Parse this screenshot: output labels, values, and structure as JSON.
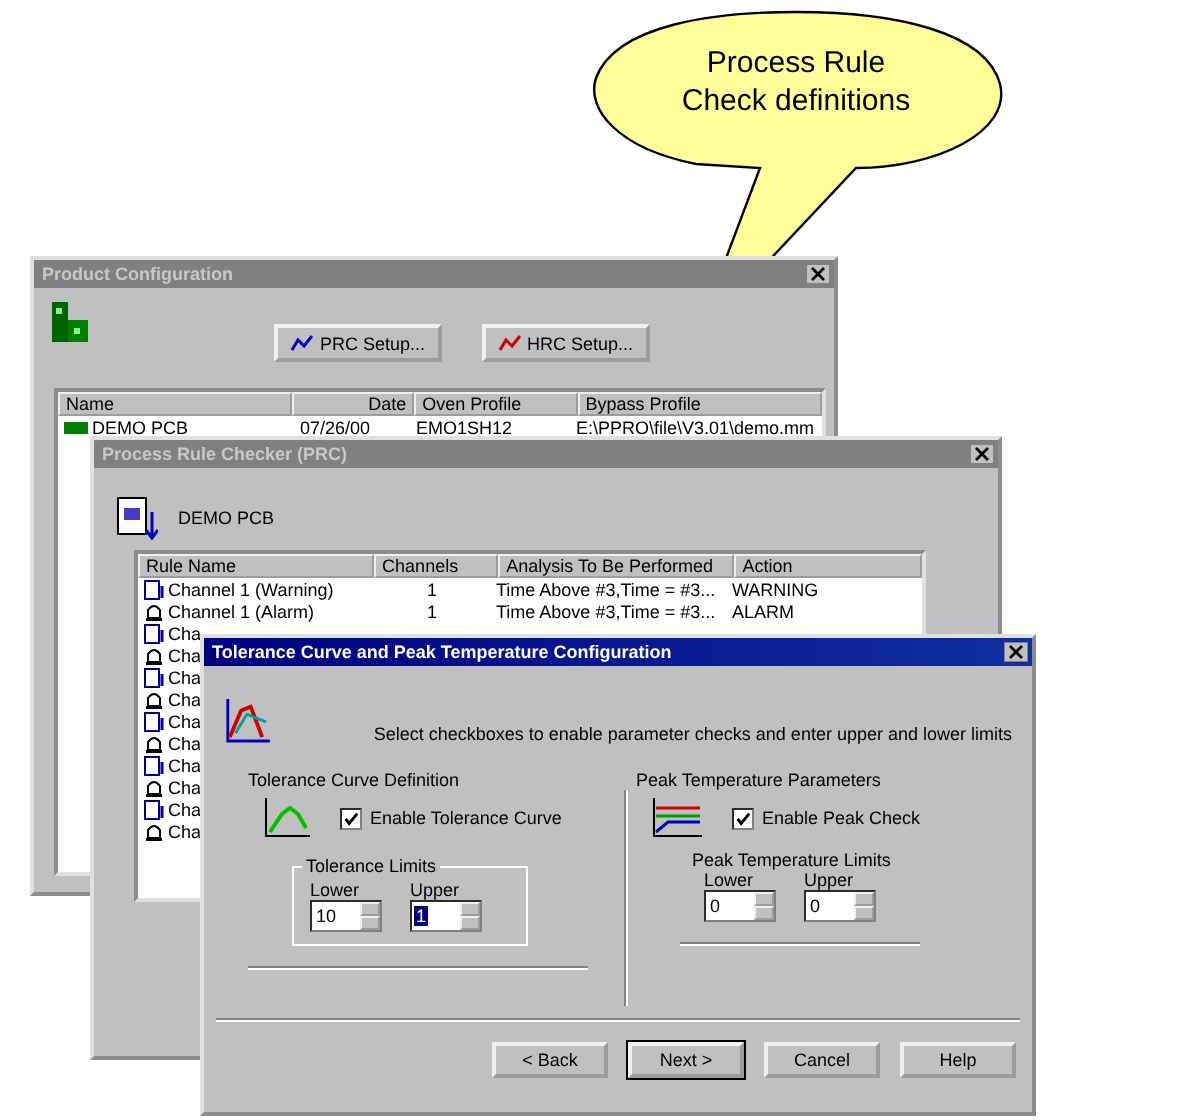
{
  "callout": {
    "lines": [
      "Process Rule",
      "Check definitions"
    ]
  },
  "product_configuration": {
    "title": "Product Configuration",
    "active": false,
    "buttons": [
      "PRC Setup...",
      "HRC Setup..."
    ],
    "columns": [
      "Name",
      "Date",
      "Oven Profile",
      "Bypass Profile"
    ],
    "rows": [
      {
        "cells": [
          "DEMO PCB",
          "07/26/00",
          "EMO1SH12",
          "E:\\PPRO\\file\\V3.01\\demo.mm"
        ]
      }
    ]
  },
  "rule_checker": {
    "title": "Process Rule Checker (PRC)",
    "active": false,
    "product": "DEMO PCB",
    "columns": [
      "Rule Name",
      "Channels",
      "Analysis To Be Performed",
      "Action"
    ],
    "rows": [
      {
        "kind": "warning",
        "name": "Channel 1 (Warning)",
        "channels": "1",
        "analysis": "Time Above #3,Time = #3...",
        "action": "WARNING"
      },
      {
        "kind": "alarm",
        "name": "Channel 1 (Alarm)",
        "channels": "1",
        "analysis": "Time Above #3,Time = #3...",
        "action": "ALARM"
      },
      {
        "kind": "warning",
        "name": "Cha"
      },
      {
        "kind": "alarm",
        "name": "Cha"
      },
      {
        "kind": "warning",
        "name": "Cha"
      },
      {
        "kind": "alarm",
        "name": "Cha"
      },
      {
        "kind": "warning",
        "name": "Cha"
      },
      {
        "kind": "alarm",
        "name": "Cha"
      },
      {
        "kind": "warning",
        "name": "Cha"
      },
      {
        "kind": "alarm",
        "name": "Cha"
      },
      {
        "kind": "warning",
        "name": "Cha"
      },
      {
        "kind": "alarm",
        "name": "Cha"
      }
    ]
  },
  "tolerance_dialog": {
    "title": "Tolerance Curve and Peak Temperature Configuration",
    "active": true,
    "instruction": "Select checkboxes to enable parameter checks and enter upper and lower limits",
    "tolerance": {
      "heading": "Tolerance Curve Definition",
      "checkbox": {
        "label": "Enable Tolerance Curve",
        "checked": true
      },
      "limits_heading": "Tolerance Limits",
      "fields": [
        {
          "label": "Lower",
          "value": "10",
          "selected": false
        },
        {
          "label": "Upper",
          "value": "1",
          "selected": true
        }
      ]
    },
    "peak": {
      "heading": "Peak Temperature Parameters",
      "checkbox": {
        "label": "Enable Peak Check",
        "checked": true
      },
      "limits_heading": "Peak Temperature Limits",
      "fields": [
        {
          "label": "Lower",
          "value": "0",
          "selected": false
        },
        {
          "label": "Upper",
          "value": "0",
          "selected": false
        }
      ]
    },
    "buttons": [
      {
        "label": "< Back",
        "default": false
      },
      {
        "label": "Next >",
        "default": true
      },
      {
        "label": "Cancel",
        "default": false
      },
      {
        "label": "Help",
        "default": false
      }
    ]
  }
}
